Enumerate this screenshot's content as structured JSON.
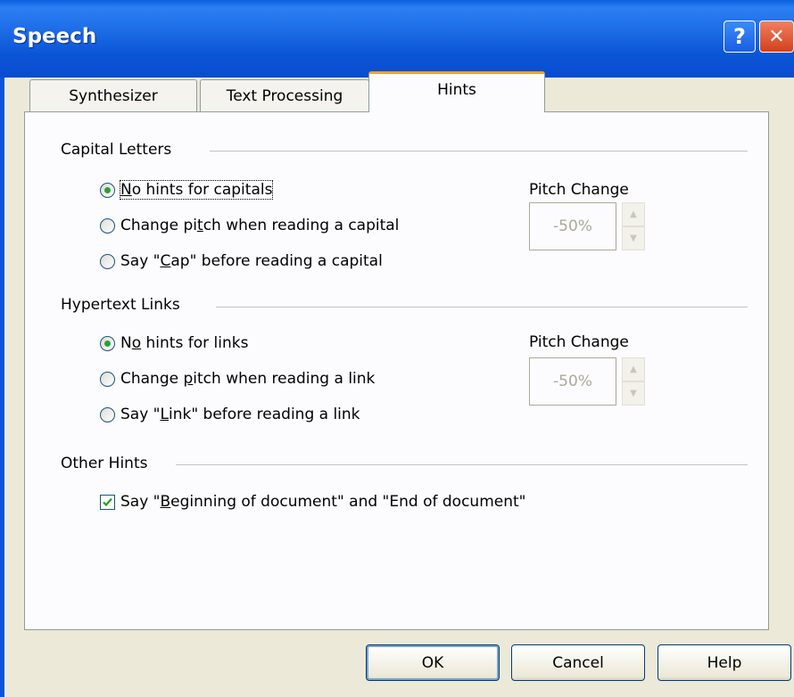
{
  "window": {
    "title": "Speech",
    "help_glyph": "?",
    "close_glyph": "✕"
  },
  "tabs": [
    {
      "label": "Synthesizer",
      "active": false
    },
    {
      "label": "Text Processing",
      "active": false
    },
    {
      "label": "Hints",
      "active": true
    }
  ],
  "capital_letters": {
    "group_label": "Capital Letters",
    "options": [
      {
        "pre": "",
        "mnemonic": "N",
        "post": "o hints for capitals",
        "selected": true
      },
      {
        "pre": "Change pi",
        "mnemonic": "t",
        "post": "ch when reading a capital",
        "selected": false
      },
      {
        "pre": "Say \"",
        "mnemonic": "C",
        "post": "ap\" before reading a capital",
        "selected": false
      }
    ],
    "pitch_label": "Pitch Change",
    "pitch_value": "-50%"
  },
  "hypertext_links": {
    "group_label": "Hypertext Links",
    "options": [
      {
        "pre": "N",
        "mnemonic": "o",
        "post": " hints for links",
        "selected": true
      },
      {
        "pre": "Change ",
        "mnemonic": "p",
        "post": "itch when reading a link",
        "selected": false
      },
      {
        "pre": "Say \"",
        "mnemonic": "L",
        "post": "ink\" before reading a link",
        "selected": false
      }
    ],
    "pitch_label": "Pitch Change",
    "pitch_value": "-50%"
  },
  "other_hints": {
    "group_label": "Other Hints",
    "checkbox": {
      "pre": "Say \"",
      "mnemonic": "B",
      "post": "eginning of document\" and \"End of document\"",
      "checked": true
    }
  },
  "buttons": {
    "ok": "OK",
    "cancel": "Cancel",
    "help": "Help"
  }
}
